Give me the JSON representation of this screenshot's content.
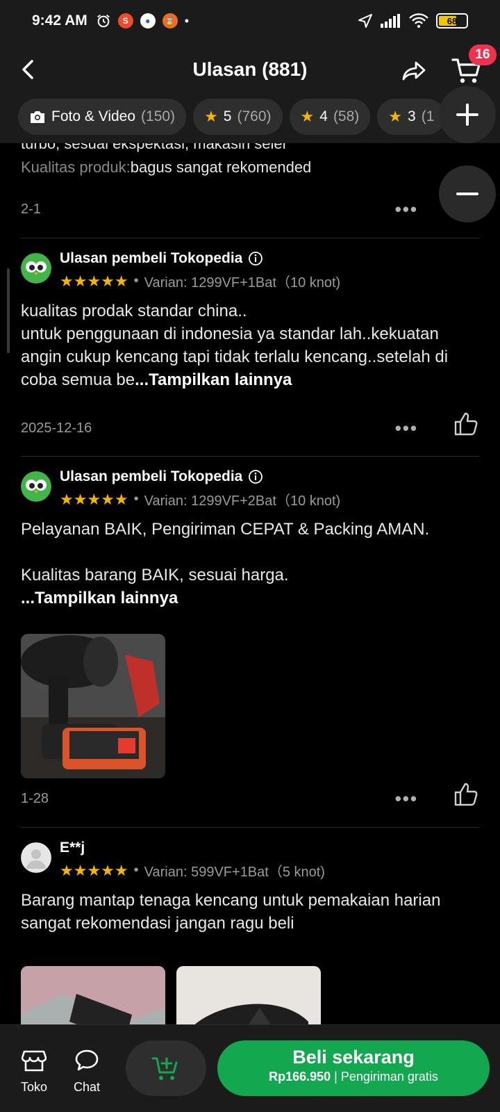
{
  "status_bar": {
    "time": "9:42 AM",
    "battery": "68"
  },
  "header": {
    "title": "Ulasan (881)",
    "cart_count": "16"
  },
  "filters": [
    {
      "label": "Foto & Video",
      "count": "(150)",
      "icon": "camera-icon"
    },
    {
      "label": "5",
      "count": "(760)",
      "icon": "star-icon"
    },
    {
      "label": "4",
      "count": "(58)",
      "icon": "star-icon"
    },
    {
      "label": "3",
      "count": "(1",
      "icon": "star-icon"
    }
  ],
  "partial_review": {
    "line1": "turbo, sesuai ekspektasi, makasih seler",
    "quality_label": "Kualitas produk:",
    "quality_value": "bagus sangat rekomended",
    "date": "2-1"
  },
  "reviews": [
    {
      "name": "Ulasan pembeli Tokopedia",
      "variant": "Varian: 1299VF+1Bat（10 knot)",
      "text": "kualitas prodak standar china..\nuntuk penggunaan di indonesia ya standar lah..kekuatan angin cukup kencang tapi tidak terlalu kencang..setelah di coba semua be",
      "more": "...Tampilkan lainnya",
      "date": "2025-12-16"
    },
    {
      "name": "Ulasan pembeli Tokopedia",
      "variant": "Varian: 1299VF+2Bat（10 knot)",
      "text": "Pelayanan BAIK, Pengiriman CEPAT & Packing AMAN.\n\nKualitas barang BAIK, sesuai harga.",
      "more": "...Tampilkan lainnya",
      "date": "1-28"
    },
    {
      "name": "E**j",
      "variant": "Varian: 599VF+1Bat（5 knot)",
      "text": "Barang mantap tenaga kencang untuk pemakaian harian sangat rekomendasi jangan ragu beli"
    }
  ],
  "bottom_bar": {
    "toko": "Toko",
    "chat": "Chat",
    "buy_title": "Beli sekarang",
    "price": "Rp166.950",
    "shipping": "Pengiriman gratis"
  },
  "colors": {
    "accent_green": "#13a84f",
    "star": "#f5b400",
    "badge_red": "#f0324e"
  }
}
